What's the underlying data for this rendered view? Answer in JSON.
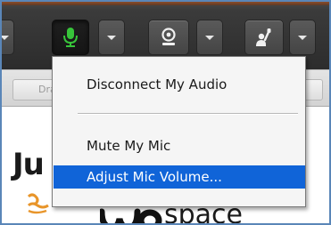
{
  "toolbar": {
    "mic_button_state": "active",
    "icons": {
      "mic": "microphone-icon",
      "camera": "webcam-icon",
      "raise_hand": "raise-hand-icon",
      "menu_caret": "chevron-down-icon"
    }
  },
  "subbar": {
    "drag_button_label": "Dra"
  },
  "menu": {
    "items": [
      {
        "label": "Disconnect My Audio",
        "highlighted": false
      },
      {
        "label": "Mute My Mic",
        "highlighted": false
      },
      {
        "label": "Adjust Mic Volume...",
        "highlighted": true
      }
    ]
  },
  "content": {
    "logo_partial_left": "Ju",
    "logo_word": "space"
  },
  "colors": {
    "toolbar_bg": "#333333",
    "mic_active_green": "#37c43a",
    "menu_highlight": "#1064d8",
    "frame_border": "#5a86b8",
    "logo_orange": "#e8952a"
  }
}
